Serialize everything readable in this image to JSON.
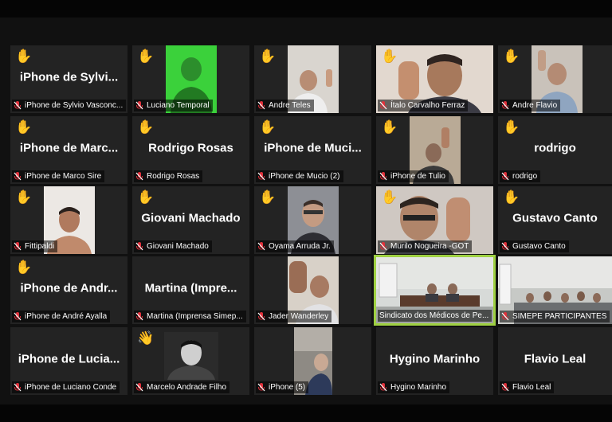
{
  "meeting": {
    "participants": [
      {
        "id": "p1",
        "tile_name": "iPhone de Sylvi...",
        "label": "iPhone de Sylvio Vasconc...",
        "hand": "✋",
        "video": false
      },
      {
        "id": "p2",
        "tile_name": "",
        "label": "Luciano Temporal",
        "hand": "✋",
        "video": true,
        "bg": "#3bd13b"
      },
      {
        "id": "p3",
        "tile_name": "",
        "label": "Andre Teles",
        "hand": "✋",
        "video": true,
        "bg": "#d9d5cf"
      },
      {
        "id": "p4",
        "tile_name": "",
        "label": "Ítalo Carvalho Ferraz",
        "hand": "✋",
        "video": true,
        "bg": "#e2d8cf"
      },
      {
        "id": "p5",
        "tile_name": "",
        "label": "Andre Flavio",
        "hand": "✋",
        "video": true,
        "bg": "#c9c2ba"
      },
      {
        "id": "p6",
        "tile_name": "iPhone de Marc...",
        "label": "iPhone de Marco Sire",
        "hand": "✋",
        "video": false
      },
      {
        "id": "p7",
        "tile_name": "Rodrigo Rosas",
        "label": "Rodrigo Rosas",
        "hand": "✋",
        "video": false
      },
      {
        "id": "p8",
        "tile_name": "iPhone de Muci...",
        "label": "iPhone de Mucio (2)",
        "hand": "✋",
        "video": false
      },
      {
        "id": "p9",
        "tile_name": "",
        "label": "iPhone de Tulio",
        "hand": "✋",
        "video": true,
        "bg": "#b9aa96"
      },
      {
        "id": "p10",
        "tile_name": "rodrigo",
        "label": "rodrigo",
        "hand": "✋",
        "video": false
      },
      {
        "id": "p11",
        "tile_name": "",
        "label": "Fittipaldi",
        "hand": "✋",
        "video": true,
        "bg": "#ece8e4"
      },
      {
        "id": "p12",
        "tile_name": "Giovani Machado",
        "label": "Giovani Machado",
        "hand": "✋",
        "video": false
      },
      {
        "id": "p13",
        "tile_name": "",
        "label": "Oyama Arruda Jr.",
        "hand": "✋",
        "video": true,
        "bg": "#8d8f95"
      },
      {
        "id": "p14",
        "tile_name": "",
        "label": "Murilo Nogueira -GOT",
        "hand": "✋",
        "video": true,
        "bg": "#cfc8c2"
      },
      {
        "id": "p15",
        "tile_name": "Gustavo Canto",
        "label": "Gustavo Canto",
        "hand": "✋",
        "video": false
      },
      {
        "id": "p16",
        "tile_name": "iPhone de Andr...",
        "label": "iPhone de André Ayalla",
        "hand": "✋",
        "video": false
      },
      {
        "id": "p17",
        "tile_name": "Martina  (Impre...",
        "label": "Martina (Imprensa Simep...",
        "hand": "",
        "video": false
      },
      {
        "id": "p18",
        "tile_name": "",
        "label": "Jader Wanderley",
        "hand": "",
        "video": true,
        "bg": "#d8d1c8"
      },
      {
        "id": "p19",
        "tile_name": "",
        "label": "Sindicato dos Médicos de Pe...",
        "hand": "",
        "video": true,
        "bg": "#d7dad8"
      },
      {
        "id": "p20",
        "tile_name": "",
        "label": "SIMEPE PARTICIPANTES",
        "hand": "",
        "video": true,
        "bg": "#c7c9c6"
      },
      {
        "id": "p21",
        "tile_name": "iPhone de Lucia...",
        "label": "iPhone de Luciano Conde",
        "hand": "",
        "video": false
      },
      {
        "id": "p22",
        "tile_name": "",
        "label": "Marcelo Andrade Filho",
        "hand": "👋",
        "video": true,
        "bg": "#2b2b2b"
      },
      {
        "id": "p23",
        "tile_name": "",
        "label": "iPhone (5)",
        "hand": "",
        "video": true,
        "bg": "#8e8a84"
      },
      {
        "id": "p24",
        "tile_name": "Hygino Marinho",
        "label": "Hygino Marinho",
        "hand": "",
        "video": false
      },
      {
        "id": "p25",
        "tile_name": "Flavio Leal",
        "label": "Flavio Leal",
        "hand": "",
        "video": false
      }
    ],
    "colors": {
      "background": "#111111",
      "tile": "#232323",
      "active_border": "#9fd142",
      "mic_muted": "#e0313b",
      "hand": "#f4c21b"
    },
    "icons": {
      "mic": "mic-muted-icon",
      "hand": "raised-hand-icon",
      "wave": "waving-hand-icon"
    }
  }
}
